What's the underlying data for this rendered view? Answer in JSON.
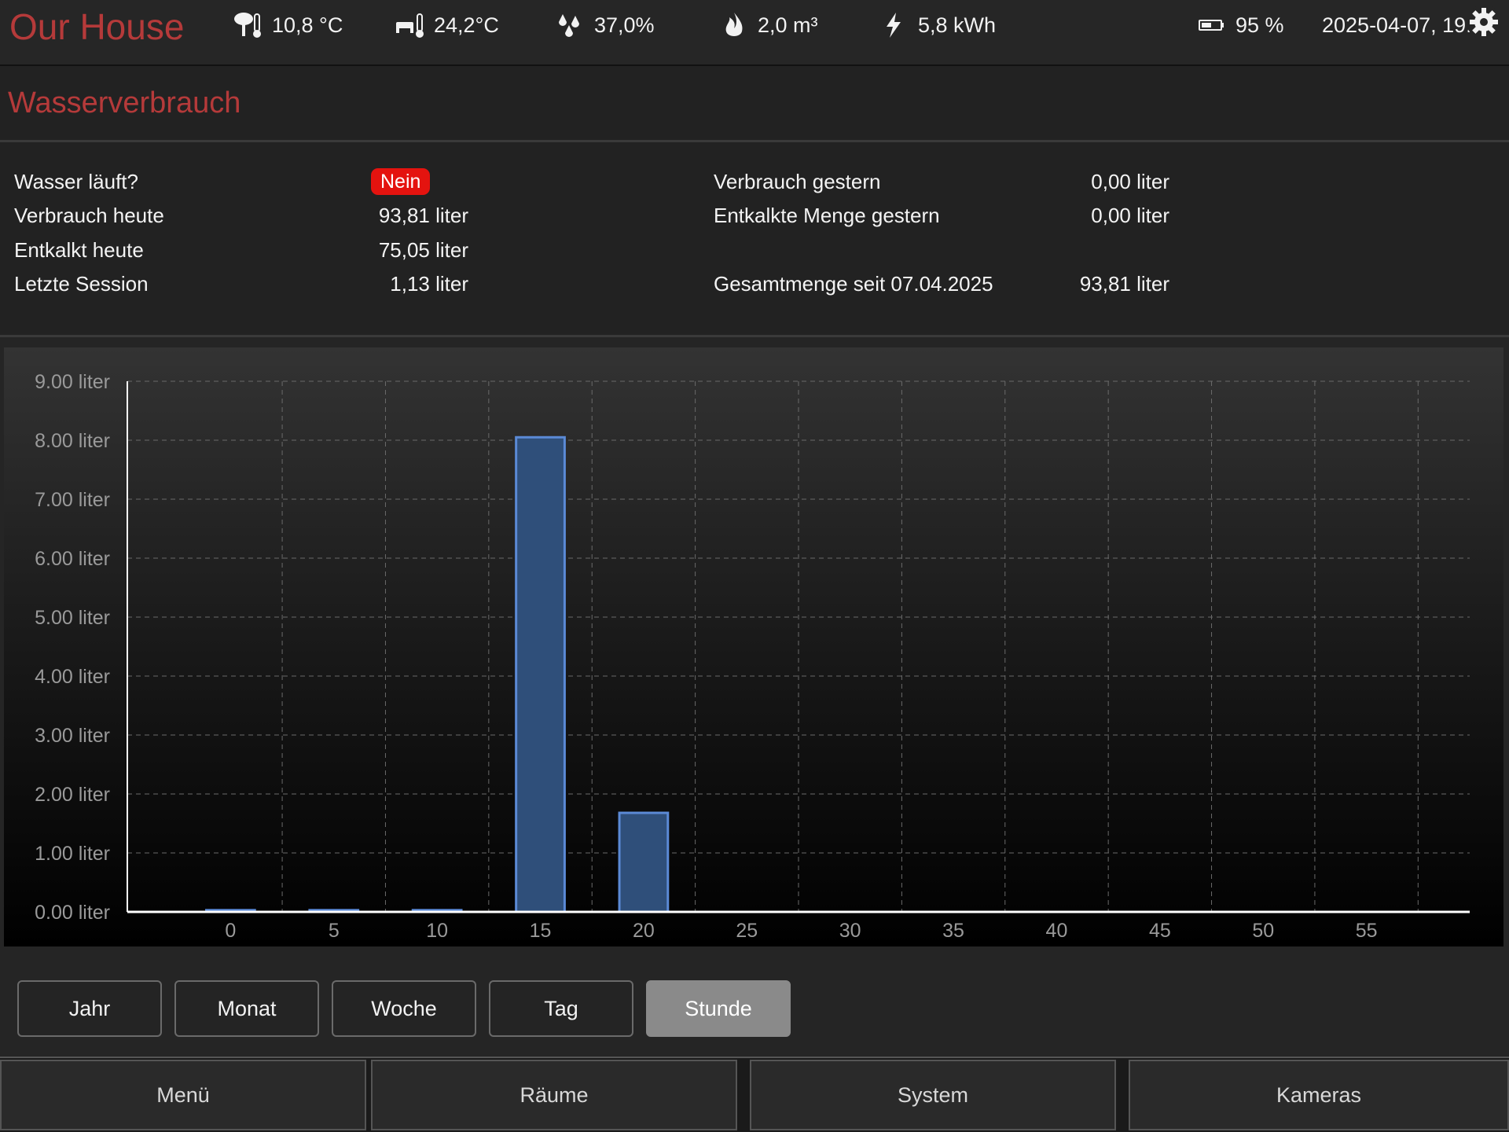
{
  "header": {
    "brand": "Our House",
    "outdoor_temp": "10,8 °C",
    "indoor_temp": "24,2°C",
    "humidity": "37,0%",
    "gas": "2,0 m³",
    "power": "5,8 kWh",
    "battery": "95 %",
    "datetime": "2025-04-07, 19:"
  },
  "section": {
    "title": "Wasserverbrauch"
  },
  "info": {
    "water_running_label": "Wasser läuft?",
    "water_running_value": "Nein",
    "today_label": "Verbrauch heute",
    "today_value": "93,81 liter",
    "decalcified_today_label": "Entkalkt heute",
    "decalcified_today_value": "75,05 liter",
    "last_session_label": "Letzte Session",
    "last_session_value": "1,13 liter",
    "yesterday_label": "Verbrauch gestern",
    "yesterday_value": "0,00 liter",
    "decalcified_yesterday_label": "Entkalkte Menge gestern",
    "decalcified_yesterday_value": "0,00 liter",
    "total_label": "Gesamtmenge seit 07.04.2025",
    "total_value": "93,81 liter"
  },
  "chart_data": {
    "type": "bar",
    "title": "",
    "xlabel": "",
    "ylabel": "",
    "x": [
      0,
      5,
      10,
      15,
      20
    ],
    "values": [
      0.03,
      0.03,
      0.03,
      8.05,
      1.68
    ],
    "xticks": [
      0,
      5,
      10,
      15,
      20,
      25,
      30,
      35,
      40,
      45,
      50,
      55
    ],
    "yticks": [
      "0.00 liter",
      "1.00 liter",
      "2.00 liter",
      "3.00 liter",
      "4.00 liter",
      "5.00 liter",
      "6.00 liter",
      "7.00 liter",
      "8.00 liter",
      "9.00 liter"
    ],
    "xlim": [
      -5,
      60
    ],
    "ylim": [
      0,
      9
    ],
    "grid": true,
    "colors": {
      "bar_fill": "#2f4f7a",
      "bar_stroke": "#5b8ad6",
      "grid": "#6a6a6a",
      "axis": "#ffffff",
      "tick_text": "#9a9a9a"
    }
  },
  "range_buttons": [
    {
      "label": "Jahr",
      "active": false
    },
    {
      "label": "Monat",
      "active": false
    },
    {
      "label": "Woche",
      "active": false
    },
    {
      "label": "Tag",
      "active": false
    },
    {
      "label": "Stunde",
      "active": true
    }
  ],
  "nav": [
    {
      "label": "Menü"
    },
    {
      "label": "Räume"
    },
    {
      "label": "System"
    },
    {
      "label": "Kameras"
    }
  ],
  "icons": {
    "outdoor": "tree-thermometer-icon",
    "indoor": "sofa-thermometer-icon",
    "humidity": "water-drops-icon",
    "gas": "flame-icon",
    "power": "lightning-icon",
    "battery": "battery-icon",
    "settings": "gear-icon"
  },
  "colors": {
    "accent": "#b53a3a",
    "badge": "#e4130f"
  }
}
